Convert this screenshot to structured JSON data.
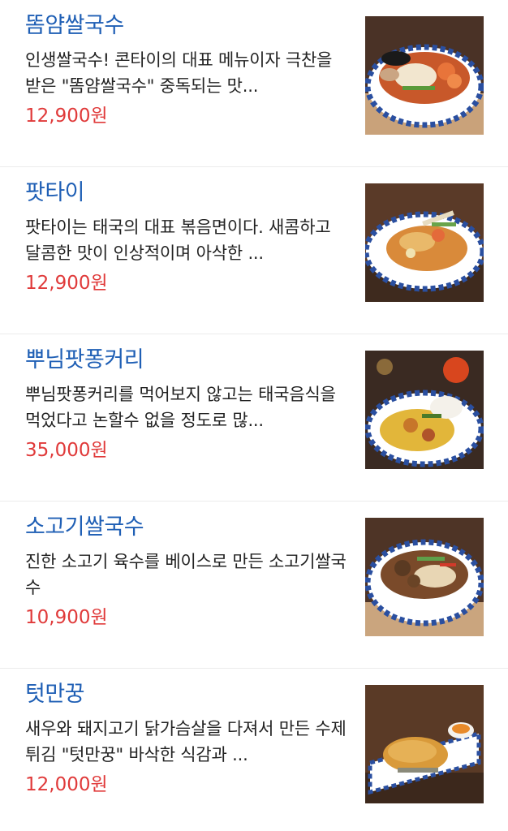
{
  "menu": {
    "items": [
      {
        "name": "똠얌쌀국수",
        "description": "인생쌀국수! 콘타이의 대표 메뉴이자 극찬을 받은 \"똠얌쌀국수\" 중독되는 맛...",
        "price": "12,900원",
        "photo_icon": "tom-yum-noodle-photo"
      },
      {
        "name": "팟타이",
        "description": "팟타이는 태국의 대표 볶음면이다. 새콤하고 달콤한 맛이 인상적이며 아삭한 ...",
        "price": "12,900원",
        "photo_icon": "pad-thai-photo"
      },
      {
        "name": "뿌님팟퐁커리",
        "description": "뿌님팟퐁커리를 먹어보지 않고는 태국음식을 먹었다고 논할수 없을 정도로 많...",
        "price": "35,000원",
        "photo_icon": "crab-curry-photo"
      },
      {
        "name": "소고기쌀국수",
        "description": "진한 소고기 육수를 베이스로 만든 소고기쌀국수",
        "price": "10,900원",
        "photo_icon": "beef-noodle-photo"
      },
      {
        "name": "텃만꿍",
        "description": "새우와 돼지고기 닭가슴살을 다져서 만든 수제 튀김 \"텃만꿍\" 바삭한 식감과 ...",
        "price": "12,000원",
        "photo_icon": "fried-shrimp-cake-photo"
      }
    ]
  },
  "colors": {
    "name": "#1f5fb5",
    "price": "#e03a3a",
    "text": "#222222",
    "divider": "#ececec"
  }
}
